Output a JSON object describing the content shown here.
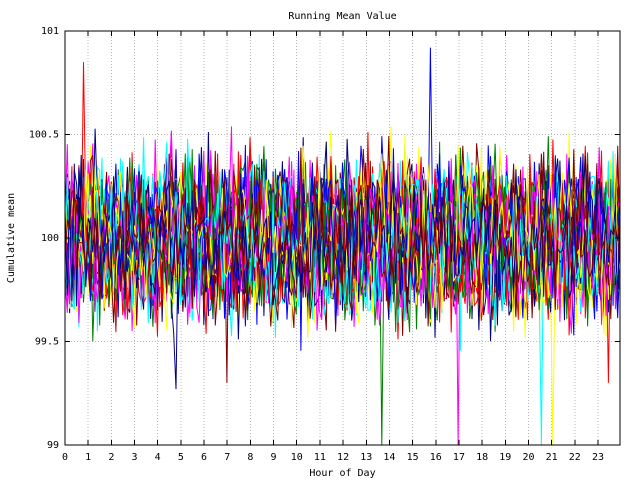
{
  "chart_data": {
    "type": "line",
    "title": "Running Mean Value",
    "xlabel": "Hour of Day",
    "ylabel": "Cumulative mean",
    "xlim": [
      0,
      23.95
    ],
    "ylim": [
      99,
      101
    ],
    "x_ticks": [
      0,
      1,
      2,
      3,
      4,
      5,
      6,
      7,
      8,
      9,
      10,
      11,
      12,
      13,
      14,
      15,
      16,
      17,
      18,
      19,
      20,
      21,
      22,
      23
    ],
    "x_tick_labels": [
      "0",
      "1",
      "2",
      "3",
      "4",
      "5",
      "6",
      "7",
      "8",
      "9",
      "10",
      "11",
      "12",
      "13",
      "14",
      "15",
      "16",
      "17",
      "18",
      "19",
      "20",
      "21",
      "22",
      "23"
    ],
    "y_ticks": [
      99,
      99.5,
      100,
      100.5,
      101
    ],
    "y_tick_labels": [
      "99",
      "99.5",
      "100",
      "100.5",
      "101"
    ],
    "grid": true,
    "legend": "none",
    "series_colors": [
      "#ff0000",
      "#008000",
      "#0000ff",
      "#ff00ff",
      "#00ffff",
      "#ffff00",
      "#000080",
      "#800000"
    ],
    "series_count": 40,
    "center_value": 100,
    "spread": 0.18,
    "notable_extremes": [
      {
        "x": 0.8,
        "y": 100.85
      },
      {
        "x": 13.7,
        "y": 99.0
      },
      {
        "x": 15.8,
        "y": 100.92
      },
      {
        "x": 17.0,
        "y": 99.0
      },
      {
        "x": 20.6,
        "y": 99.0
      },
      {
        "x": 21.1,
        "y": 99.0
      },
      {
        "x": 4.8,
        "y": 99.27
      },
      {
        "x": 7.0,
        "y": 99.3
      },
      {
        "x": 23.5,
        "y": 99.3
      }
    ]
  }
}
